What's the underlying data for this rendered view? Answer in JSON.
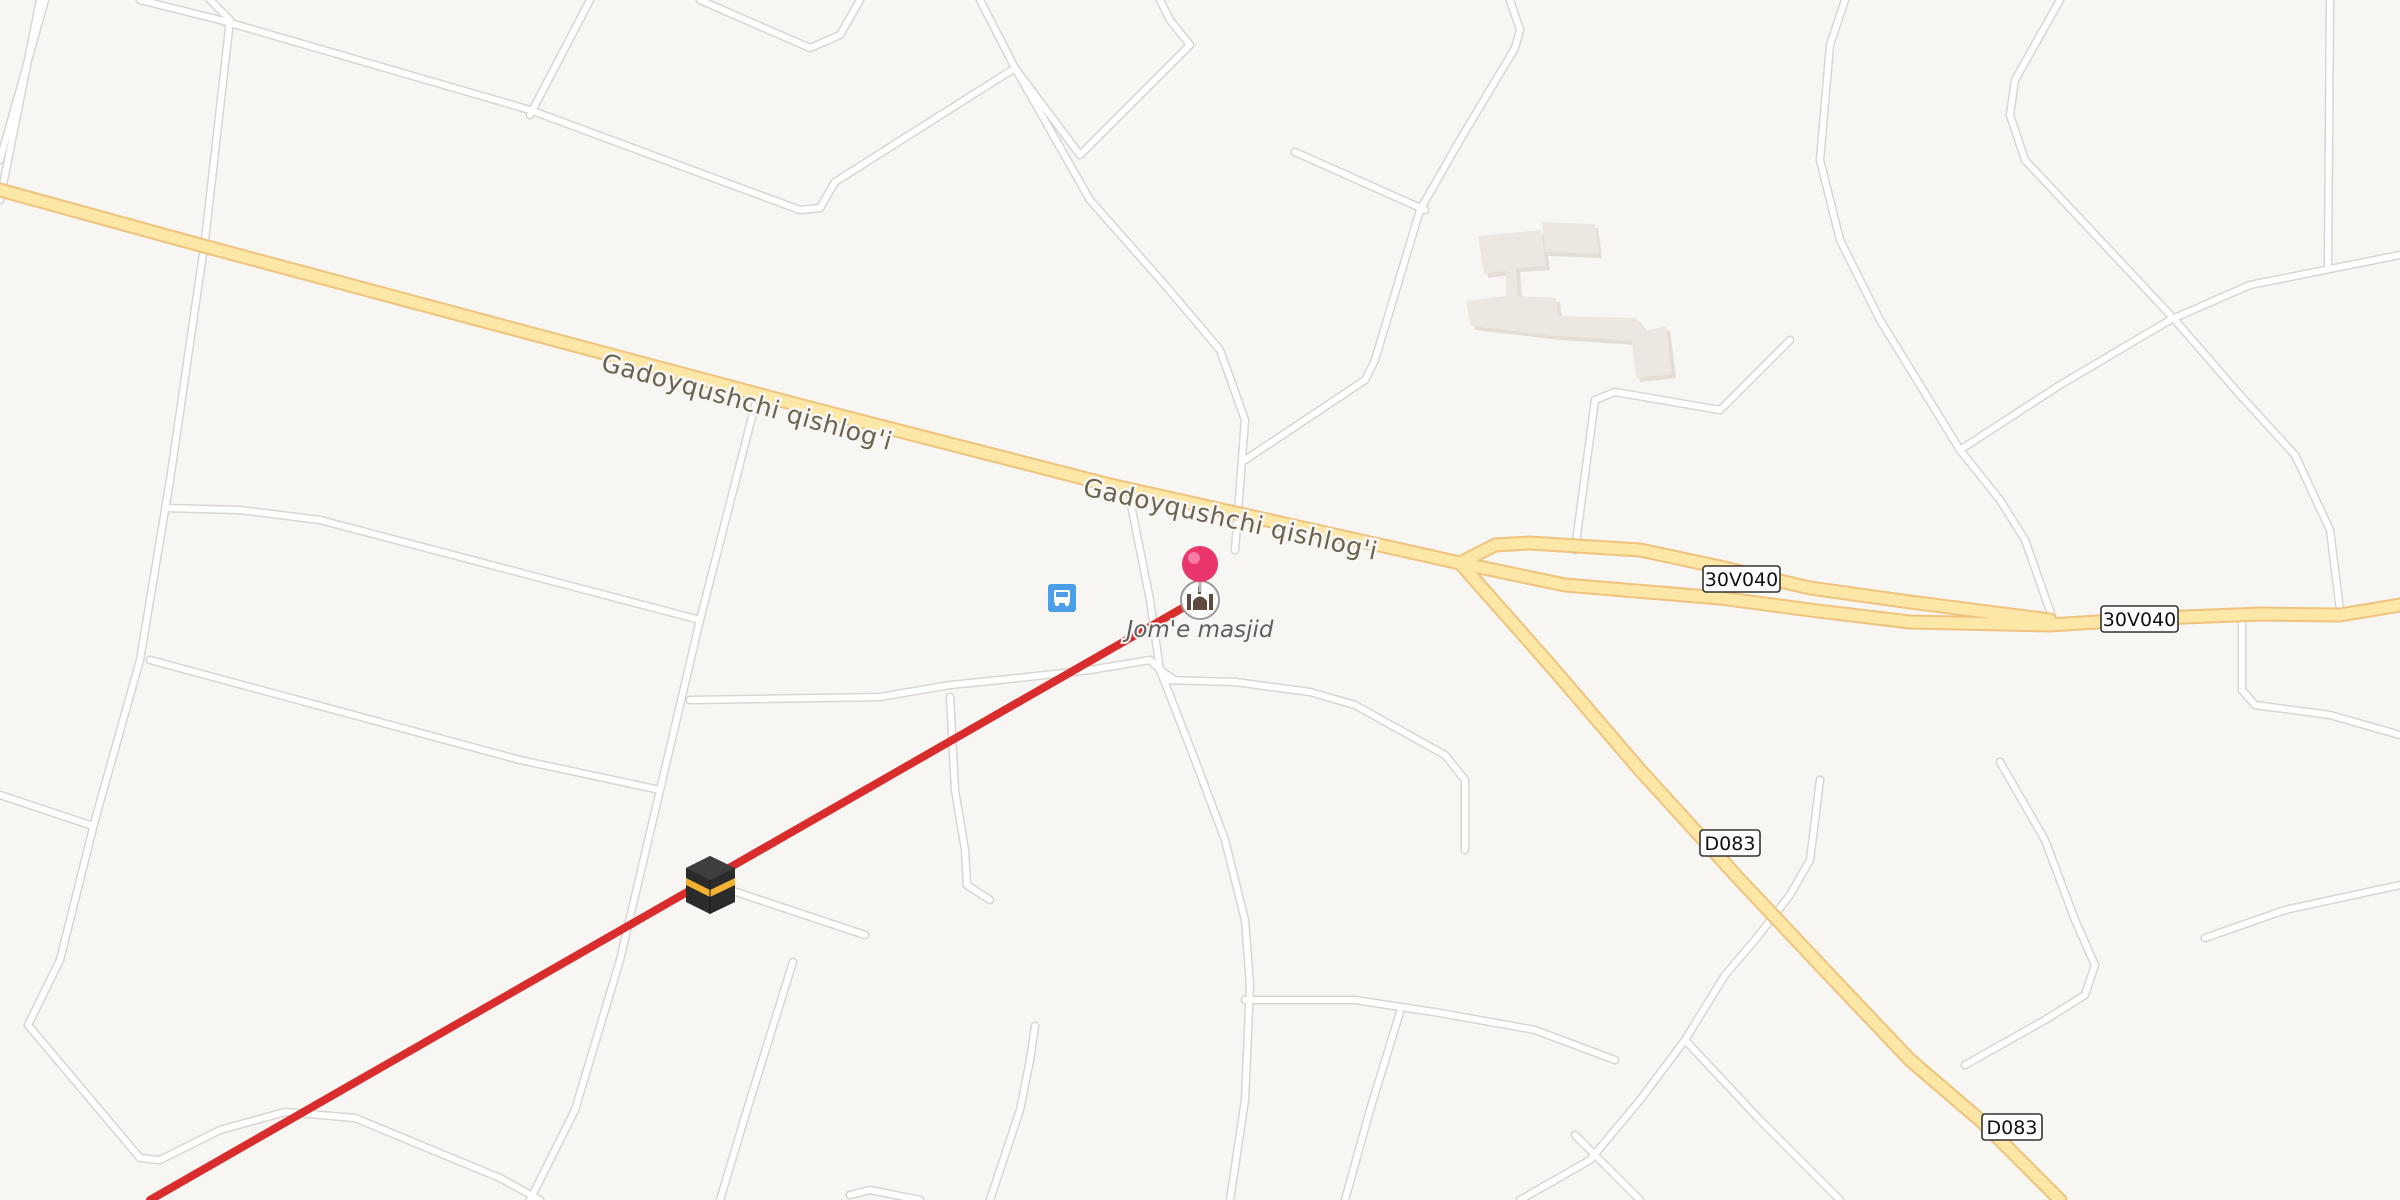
{
  "map": {
    "road_labels": {
      "main_road_west": "Gadoyqushchi qishlog'i",
      "main_road_center": "Gadoyqushchi qishlog'i"
    },
    "route_shields": {
      "east_1": "30V040",
      "east_2": "30V040",
      "south_1": "D083",
      "south_2": "D083"
    },
    "poi": {
      "mosque_label": "Jom'e masjid"
    },
    "colors": {
      "background": "#f8f6f3",
      "minor_road": "#ffffff",
      "main_road": "#fde7a6",
      "qibla_line": "#d92d2d",
      "pin": "#e8356a",
      "bus_stop": "#4b9ee8",
      "building": "#ebe5df"
    },
    "icons": [
      "location-pin-icon",
      "mosque-icon",
      "bus-stop-icon",
      "kaaba-icon"
    ]
  }
}
